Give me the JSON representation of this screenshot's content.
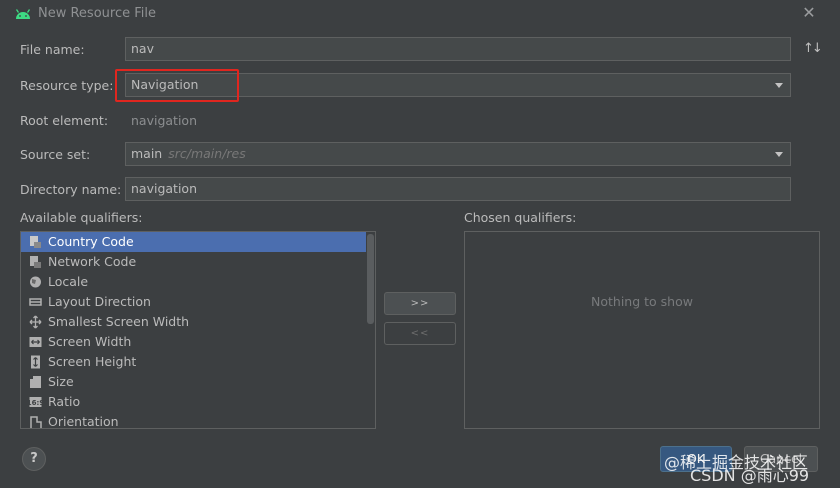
{
  "window": {
    "title": "New Resource File",
    "icon": "android-icon",
    "close_icon": "close-icon"
  },
  "form": {
    "file_name": {
      "label": "File name:",
      "value": "nav"
    },
    "sort_icon": "sort-icon",
    "resource_type": {
      "label": "Resource type:",
      "value": "Navigation"
    },
    "root_element": {
      "label": "Root element:",
      "value": "navigation"
    },
    "source_set": {
      "label": "Source set:",
      "value": "main",
      "hint": "src/main/res"
    },
    "directory_name": {
      "label": "Directory name:",
      "value": "navigation"
    }
  },
  "qualifiers": {
    "available_label": "Available qualifiers:",
    "chosen_label": "Chosen qualifiers:",
    "empty_text": "Nothing to show",
    "add_button": ">>",
    "remove_button": "<<",
    "items": [
      {
        "label": "Country Code",
        "icon": "country-code-icon",
        "selected": true
      },
      {
        "label": "Network Code",
        "icon": "network-code-icon"
      },
      {
        "label": "Locale",
        "icon": "globe-icon"
      },
      {
        "label": "Layout Direction",
        "icon": "layout-direction-icon"
      },
      {
        "label": "Smallest Screen Width",
        "icon": "smallest-width-icon"
      },
      {
        "label": "Screen Width",
        "icon": "screen-width-icon"
      },
      {
        "label": "Screen Height",
        "icon": "screen-height-icon"
      },
      {
        "label": "Size",
        "icon": "size-icon"
      },
      {
        "label": "Ratio",
        "icon": "ratio-icon"
      },
      {
        "label": "Orientation",
        "icon": "orientation-icon"
      }
    ]
  },
  "footer": {
    "help_label": "?",
    "ok_label": "OK",
    "cancel_label": "Cancel"
  },
  "watermark": {
    "line1": "@稀土掘金技术社区",
    "line2": "CSDN @雨心99"
  },
  "colors": {
    "accent_selected": "#4b6eaf",
    "highlight": "#e0261f",
    "background": "#3c3f41"
  }
}
